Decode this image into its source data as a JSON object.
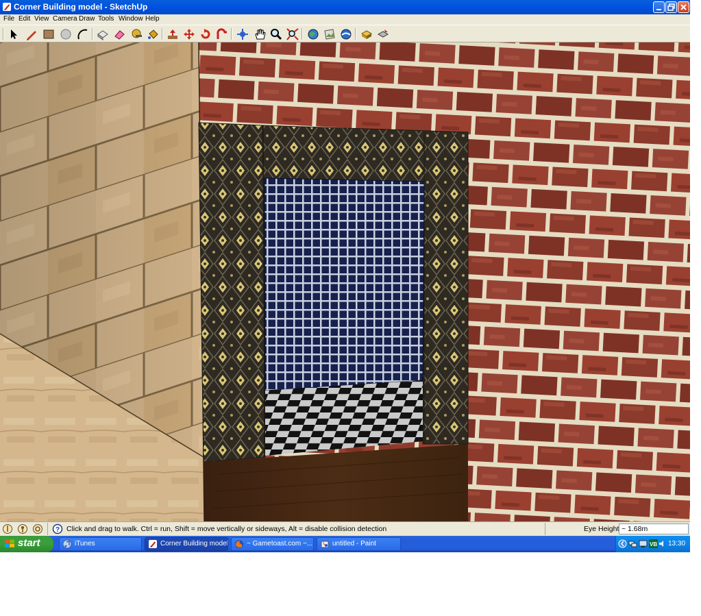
{
  "window": {
    "title": "Corner Building model - SketchUp"
  },
  "menu": {
    "items": [
      "File",
      "Edit",
      "View",
      "Camera",
      "Draw",
      "Tools",
      "Window",
      "Help"
    ]
  },
  "toolbar": {
    "tools": [
      "select-tool",
      "pencil-line-tool",
      "rectangle-tool",
      "circle-tool",
      "arc-tool",
      "make-component-tool",
      "eraser-tool",
      "tape-measure-tool",
      "paint-bucket-tool",
      "push-pull-tool",
      "move-tool",
      "rotate-tool",
      "follow-me-tool",
      "orbit-tool",
      "pan-tool",
      "zoom-tool",
      "zoom-extents-tool",
      "get-models-tool",
      "share-model-tool",
      "components-tool",
      "get-photo-texture-tool",
      "place-model-tool"
    ]
  },
  "statusbar": {
    "message": "Click and drag to walk.  Ctrl = run, Shift = move vertically or sideways, Alt =  disable collision detection",
    "eye_height_label": "Eye Height",
    "eye_height_value": "~ 1.68m"
  },
  "taskbar": {
    "start_label": "start",
    "tasks": [
      {
        "label": "iTunes",
        "active": false
      },
      {
        "label": "Corner Building model...",
        "active": true
      },
      {
        "label": "~ Gametoast.com ~...",
        "active": false
      },
      {
        "label": "untitled - Paint",
        "active": false
      }
    ],
    "clock": "13:30"
  },
  "colors": {
    "titlebar": "#0054e3",
    "chrome": "#ece9d8",
    "taskbar": "#245edb",
    "start_button": "#3a9e3a",
    "brick": "#8e3a2c",
    "mortar": "#e8dcc0",
    "sandstone": "#c9ad80",
    "wallpaper": "#3b3528",
    "tile_blue": "#1b2a5e",
    "floor_wood": "#4a2a12"
  }
}
